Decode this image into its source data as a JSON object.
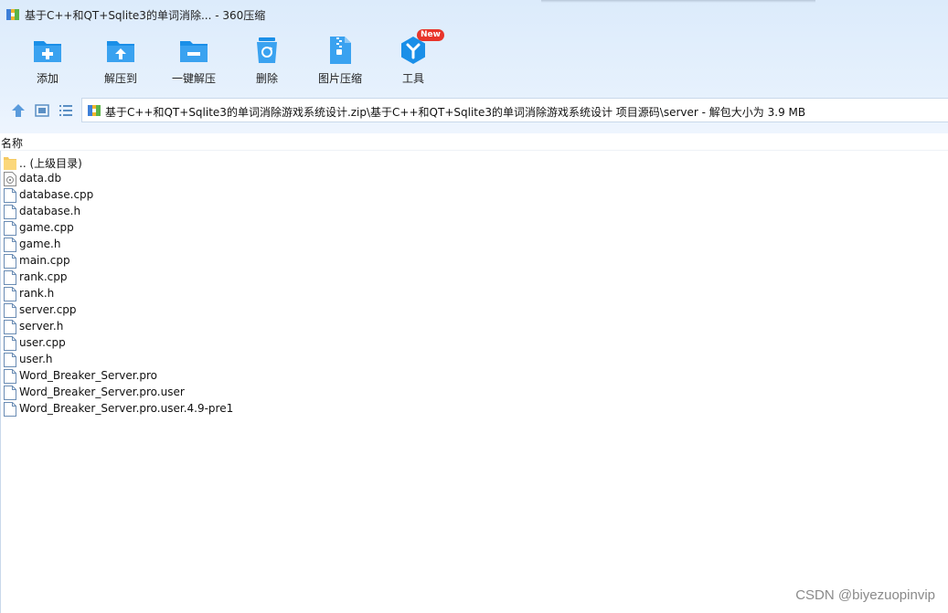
{
  "window": {
    "title": "基于C++和QT+Sqlite3的单词消除... - 360压缩"
  },
  "toolbar": {
    "items": [
      {
        "id": "add",
        "label": "添加",
        "icon": "folder-plus-icon"
      },
      {
        "id": "extract",
        "label": "解压到",
        "icon": "folder-upload-icon"
      },
      {
        "id": "one_click",
        "label": "一键解压",
        "icon": "folder-minus-icon"
      },
      {
        "id": "delete",
        "label": "删除",
        "icon": "recycle-bin-icon"
      },
      {
        "id": "image",
        "label": "图片压缩",
        "icon": "zip-file-icon"
      },
      {
        "id": "tools",
        "label": "工具",
        "icon": "tools-hex-icon",
        "badge": "New"
      }
    ]
  },
  "address": {
    "path": "基于C++和QT+Sqlite3的单词消除游戏系统设计.zip\\基于C++和QT+Sqlite3的单词消除游戏系统设计 项目源码\\server - 解包大小为 3.9 MB"
  },
  "list": {
    "column_name": "名称",
    "files": [
      {
        "name": ".. (上级目录)",
        "icon": "folder-icon"
      },
      {
        "name": "data.db",
        "icon": "db-file-icon"
      },
      {
        "name": "database.cpp",
        "icon": "file-icon"
      },
      {
        "name": "database.h",
        "icon": "file-icon"
      },
      {
        "name": "game.cpp",
        "icon": "file-icon"
      },
      {
        "name": "game.h",
        "icon": "file-icon"
      },
      {
        "name": "main.cpp",
        "icon": "file-icon"
      },
      {
        "name": "rank.cpp",
        "icon": "file-icon"
      },
      {
        "name": "rank.h",
        "icon": "file-icon"
      },
      {
        "name": "server.cpp",
        "icon": "file-icon"
      },
      {
        "name": "server.h",
        "icon": "file-icon"
      },
      {
        "name": "user.cpp",
        "icon": "file-icon"
      },
      {
        "name": "user.h",
        "icon": "file-icon"
      },
      {
        "name": "Word_Breaker_Server.pro",
        "icon": "file-icon"
      },
      {
        "name": "Word_Breaker_Server.pro.user",
        "icon": "file-icon"
      },
      {
        "name": "Word_Breaker_Server.pro.user.4.9-pre1",
        "icon": "file-icon"
      }
    ]
  },
  "watermark": "CSDN @biyezuopinvip",
  "colors": {
    "accent": "#1a8fe8",
    "header_bg": "#e3eefb",
    "badge": "#e8352b"
  }
}
